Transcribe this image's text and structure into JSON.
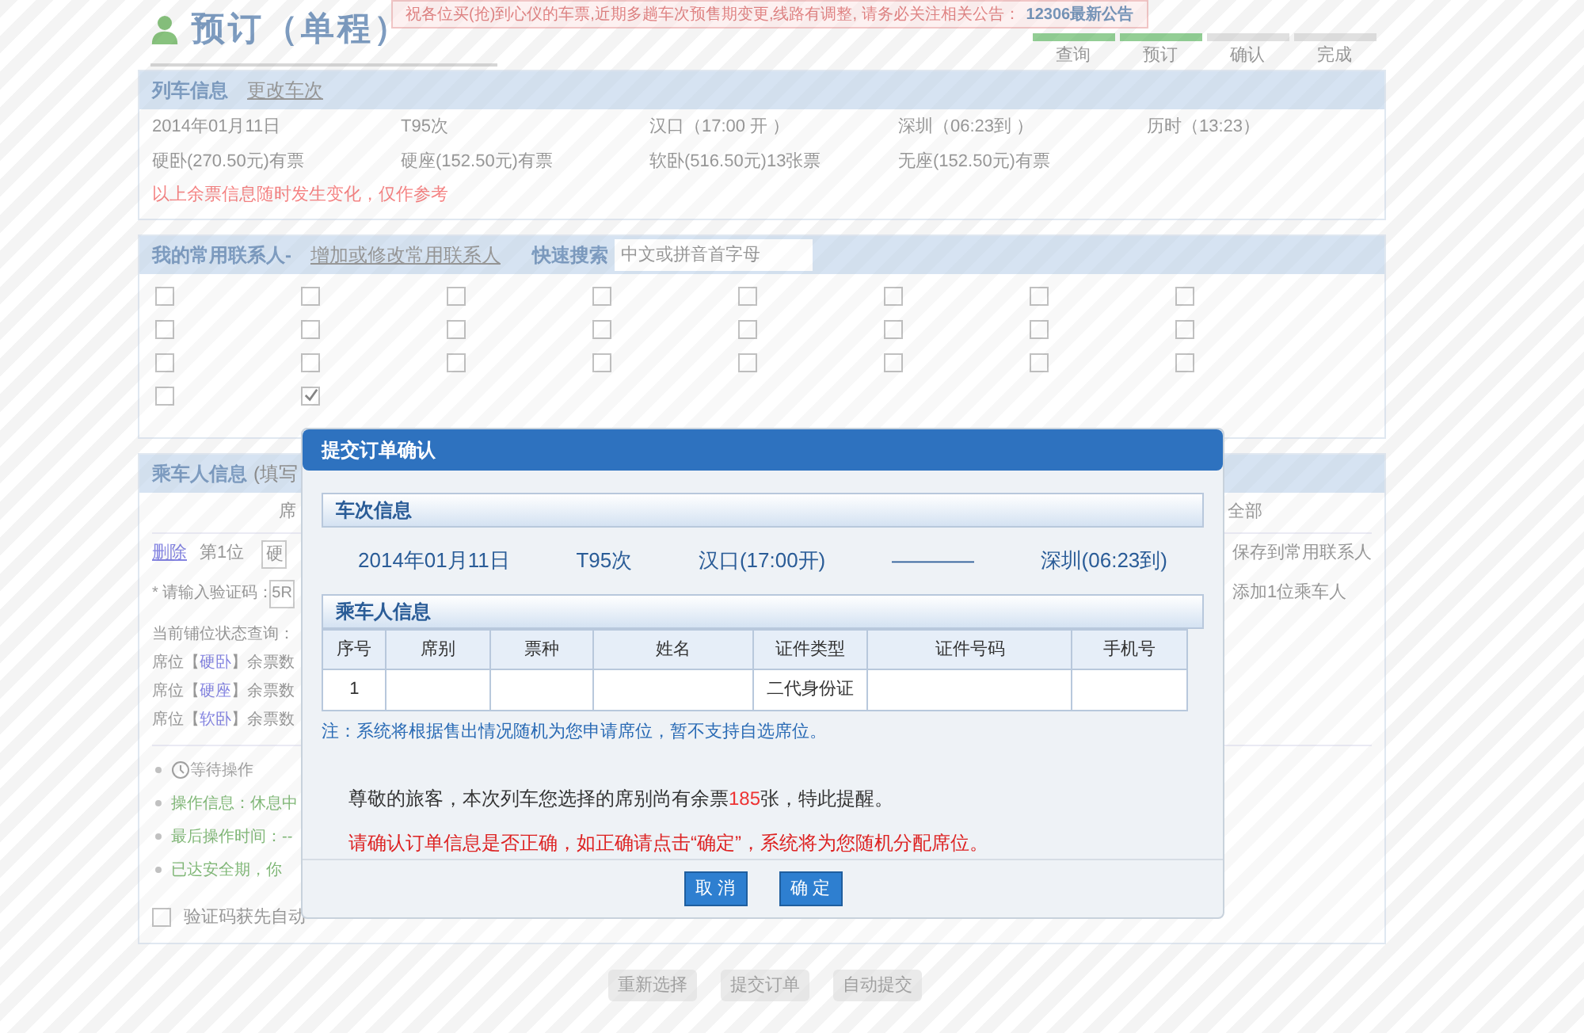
{
  "header": {
    "title": "预订（单程）",
    "notice": "祝各位买(抢)到心仪的车票,近期多趟车次预售期变更,线路有调整, 请务必关注相关公告：",
    "notice_link": "12306最新公告"
  },
  "steps": [
    {
      "label": "查询",
      "done": true
    },
    {
      "label": "预订",
      "done": true
    },
    {
      "label": "确认",
      "done": false
    },
    {
      "label": "完成",
      "done": false
    }
  ],
  "train_info": {
    "title": "列车信息",
    "link": "更改车次",
    "details": [
      "2014年01月11日",
      "T95次",
      "汉口（17:00 开 ）",
      "深圳（06:23到 ）",
      "历时（13:23）"
    ],
    "prices": [
      "硬卧(270.50元)有票",
      "硬座(152.50元)有票",
      "软卧(516.50元)13张票",
      "无座(152.50元)有票"
    ],
    "note": "以上余票信息随时发生变化，仅作参考"
  },
  "contacts": {
    "title": "我的常用联系人-",
    "link": "增加或修改常用联系人",
    "search_label": "快速搜索",
    "search_placeholder": "中文或拼音首字母",
    "items": [
      {
        "checked": false
      },
      {
        "checked": false
      },
      {
        "checked": false
      },
      {
        "checked": false
      },
      {
        "checked": false
      },
      {
        "checked": false
      },
      {
        "checked": false
      },
      {
        "checked": false
      },
      {
        "checked": false
      },
      {
        "checked": false
      },
      {
        "checked": false
      },
      {
        "checked": false
      },
      {
        "checked": false
      },
      {
        "checked": false
      },
      {
        "checked": false
      },
      {
        "checked": false
      },
      {
        "checked": false
      },
      {
        "checked": false
      },
      {
        "checked": false
      },
      {
        "checked": false
      },
      {
        "checked": false
      },
      {
        "checked": false
      },
      {
        "checked": false
      },
      {
        "checked": false
      },
      {
        "checked": false
      },
      {
        "checked": true
      }
    ]
  },
  "passengers": {
    "title": "乘车人信息",
    "hint": "(填写",
    "column_header": "席",
    "select_all": "全部",
    "delete_link": "删除",
    "position": "第1位",
    "seat_select": "硬",
    "save_contact": "保存到常用联系人",
    "captcha_label": "* 请输入验证码：",
    "captcha_value": "5R",
    "add_passenger": "添加1位乘车人",
    "status_title": "当前铺位状态查询：",
    "seat_status": [
      {
        "prefix": "席位【",
        "seat": "硬卧",
        "suffix": "】余票数"
      },
      {
        "prefix": "席位【",
        "seat": "硬座",
        "suffix": "】余票数"
      },
      {
        "prefix": "席位【",
        "seat": "软卧",
        "suffix": "】余票数"
      }
    ],
    "log": [
      {
        "kind": "waiting",
        "text": "等待操作"
      },
      {
        "kind": "info",
        "text": "操作信息：休息中"
      },
      {
        "kind": "info",
        "text": "最后操作时间：--"
      },
      {
        "kind": "info",
        "text": "已达安全期，你"
      }
    ],
    "auto_checkbox": {
      "label": "验证码获先自动",
      "checked": false
    }
  },
  "actions": [
    "重新选择",
    "提交订单",
    "自动提交"
  ],
  "dialog": {
    "title": "提交订单确认",
    "train_section": "车次信息",
    "train": [
      "2014年01月11日",
      "T95次",
      "汉口(17:00开)",
      "————",
      "深圳(06:23到)"
    ],
    "passenger_section": "乘车人信息",
    "columns": [
      "序号",
      "席别",
      "票种",
      "姓名",
      "证件类型",
      "证件号码",
      "手机号"
    ],
    "rows": [
      [
        "1",
        "",
        "",
        "",
        "二代身份证",
        "",
        ""
      ]
    ],
    "note": "注：系统将根据售出情况随机为您申请席位，暂不支持自选席位。",
    "remaining": {
      "before": "尊敬的旅客，本次列车您选择的席别尚有余票",
      "count": "185",
      "after": "张，特此提醒。"
    },
    "warning": "请确认订单信息是否正确，如正确请点击“确定”，系统将为您随机分配席位。",
    "buttons": [
      "取 消",
      "确 定"
    ]
  }
}
